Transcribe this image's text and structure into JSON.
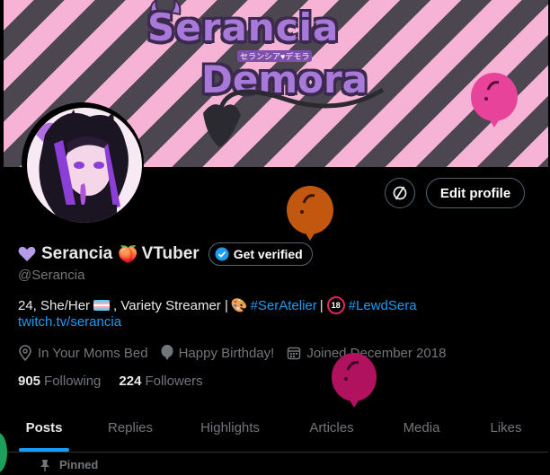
{
  "banner": {
    "title_line1": "Serancia",
    "title_line2": "Demora",
    "title_kana": "セランシア♥デモラ"
  },
  "profile": {
    "display_name": "Serancia",
    "name_suffix": "VTuber",
    "verified_label": "Get verified",
    "handle": "@Serancia",
    "edit_profile_label": "Edit profile",
    "bio": {
      "part1": "24, She/Her",
      "part2": ", Variety Streamer |",
      "hashtag1": "#SerAtelier",
      "separator": "|",
      "hashtag2": "#LewdSera"
    },
    "url": "twitch.tv/serancia",
    "location": "In Your Moms Bed",
    "birthday": "Happy Birthday!",
    "joined": "Joined December 2018",
    "following_count": "905",
    "following_label": "Following",
    "followers_count": "224",
    "followers_label": "Followers"
  },
  "tabs": [
    {
      "label": "Posts",
      "active": true
    },
    {
      "label": "Replies"
    },
    {
      "label": "Highlights"
    },
    {
      "label": "Articles"
    },
    {
      "label": "Media"
    },
    {
      "label": "Likes"
    }
  ],
  "pinned_label": "Pinned",
  "colors": {
    "accent": "#1d9bf0",
    "background": "#000000",
    "balloon_orange": "#c2570f",
    "balloon_pink": "#e8439a",
    "balloon_magenta": "#b0125f"
  },
  "icons": {
    "heart": "purple-heart-icon",
    "peach": "peach-icon",
    "verified": "verified-badge-icon",
    "location": "location-pin-icon",
    "balloon": "balloon-icon",
    "calendar": "calendar-icon",
    "pin": "pin-icon",
    "spaces": "circle-slash-icon"
  }
}
